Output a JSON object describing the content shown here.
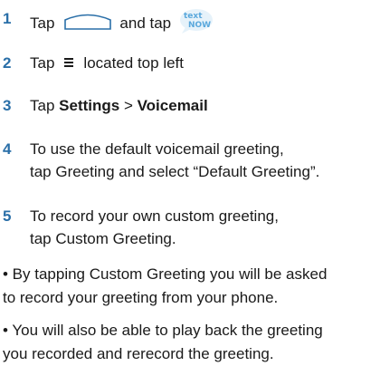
{
  "steps": [
    {
      "number": "1",
      "pre": "Tap",
      "mid": "and tap",
      "logo_text_1": "text",
      "logo_text_2": "NOW"
    },
    {
      "number": "2",
      "pre": "Tap",
      "post": "located top left"
    },
    {
      "number": "3",
      "pre": "Tap",
      "bold1": "Settings",
      "sep": " > ",
      "bold2": "Voicemail"
    },
    {
      "number": "4",
      "line1": "To use the default voicemail greeting,",
      "line2": "tap Greeting and select “Default Greeting”."
    },
    {
      "number": "5",
      "line1": "To record your own custom greeting,",
      "line2": "tap Custom Greeting."
    }
  ],
  "bullets": [
    {
      "line1": "• By tapping Custom Greeting you will be asked",
      "line2": "to record your greeting from your phone."
    },
    {
      "line1": "• You will also be able to play back the greeting",
      "line2": "you recorded and rerecord the greeting."
    }
  ],
  "colors": {
    "number": "#2a6fa8",
    "text": "#1a1a1a",
    "logo": "#5aa8dc"
  }
}
